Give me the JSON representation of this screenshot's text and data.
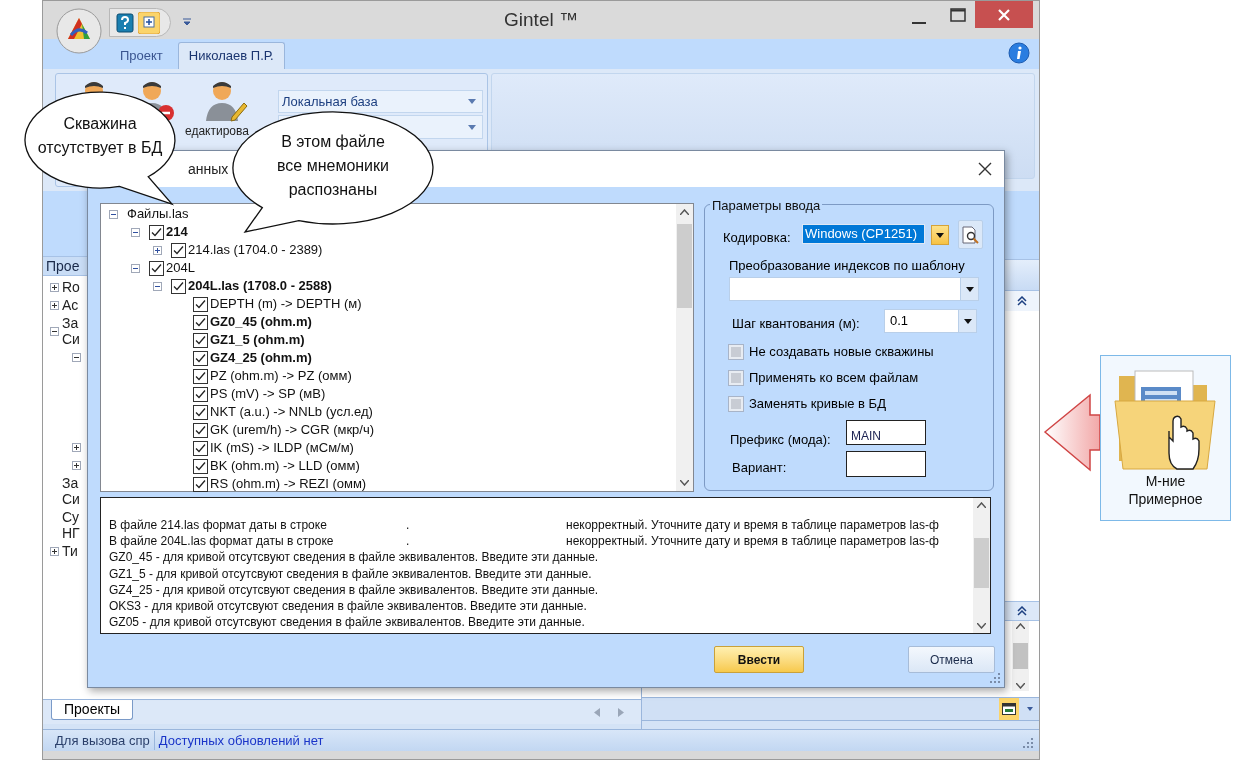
{
  "window": {
    "title": "Gintel ™"
  },
  "ribbon": {
    "tabs": [
      {
        "label": "Проект",
        "selected": false
      },
      {
        "label": "Николаев П.Р.",
        "selected": true
      }
    ],
    "edit_label": "едактирова",
    "database": {
      "value": "Локальная база"
    }
  },
  "left_panel": {
    "header": "Прое",
    "items": [
      {
        "lines": [
          "Ro"
        ],
        "expanded": false
      },
      {
        "lines": [
          "Ac"
        ],
        "expanded": false
      },
      {
        "lines": [
          "За",
          "Си"
        ],
        "expanded": true,
        "children": [
          {
            "expanded": true
          },
          {
            "expanded": false
          },
          {
            "expanded": false
          }
        ]
      },
      {
        "lines": [
          "За",
          "Си"
        ]
      },
      {
        "lines": [
          "Су",
          "НГ"
        ]
      },
      {
        "lines": [
          "Ти"
        ],
        "expanded": false
      }
    ],
    "tabs": [
      {
        "label": "Проекты",
        "selected": true
      }
    ]
  },
  "status_bar": [
    {
      "text": "Для вызова спр",
      "kind": "hint"
    },
    {
      "text": "Доступных обновлений нет",
      "kind": "info"
    }
  ],
  "dialog": {
    "title": "анных",
    "tree": {
      "label": "Файлы.las",
      "expanded": true,
      "children": [
        {
          "label": "214",
          "bold": true,
          "checked": true,
          "expanded": true,
          "children": [
            {
              "label": "214.las (1704.0 - 2389)",
              "bold": false,
              "checked": true,
              "expanded": false
            }
          ]
        },
        {
          "label": "204L",
          "bold": false,
          "checked": true,
          "expanded": true,
          "children": [
            {
              "label": "204L.las (1708.0 - 2588)",
              "bold": true,
              "checked": true,
              "expanded": true,
              "children": [
                {
                  "label": "DEPTH (m) -> DEPTH (м)",
                  "bold": false,
                  "checked": true
                },
                {
                  "label": "GZ0_45 (ohm.m)",
                  "bold": true,
                  "checked": true
                },
                {
                  "label": "GZ1_5 (ohm.m)",
                  "bold": true,
                  "checked": true
                },
                {
                  "label": "GZ4_25 (ohm.m)",
                  "bold": true,
                  "checked": true
                },
                {
                  "label": "PZ (ohm.m) -> PZ (омм)",
                  "bold": false,
                  "checked": true
                },
                {
                  "label": "PS (mV) -> SP (мВ)",
                  "bold": false,
                  "checked": true
                },
                {
                  "label": "NKT (a.u.) -> NNLb (усл.ед)",
                  "bold": false,
                  "checked": true
                },
                {
                  "label": "GK (urem/h) -> CGR (мкр/ч)",
                  "bold": false,
                  "checked": true
                },
                {
                  "label": "IK (mS) -> ILDP (мСм/м)",
                  "bold": false,
                  "checked": true
                },
                {
                  "label": "BK (ohm.m) -> LLD (омм)",
                  "bold": false,
                  "checked": true
                },
                {
                  "label": "RS (ohm.m) -> REZI (омм)",
                  "bold": false,
                  "checked": true
                }
              ]
            }
          ]
        }
      ]
    },
    "params": {
      "title": "Параметры ввода",
      "encoding": {
        "label": "Кодировка:",
        "value": "Windows (CP1251)"
      },
      "template": {
        "label": "Преобразование индексов по шаблону"
      },
      "step": {
        "label": "Шаг квантования (м):",
        "value": "0.1"
      },
      "options": [
        {
          "label": "Не создавать новые скважины",
          "checked": false
        },
        {
          "label": "Применять ко всем файлам",
          "checked": false
        },
        {
          "label": "Заменять кривые в БД",
          "checked": false
        }
      ],
      "prefix": {
        "label": "Префикс (мода):",
        "value": "MAIN"
      },
      "variant": {
        "label": "Вариант:"
      }
    },
    "log": [
      {
        "parts": [
          "В файле 214.las формат даты в строке",
          ".",
          "некорректный. Уточните дату и время в таблице параметров las-ф"
        ]
      },
      {
        "parts": [
          "В файле 204L.las формат даты в строке",
          ".",
          "некорректный. Уточните дату и время в таблице параметров las-ф"
        ]
      },
      {
        "parts": [
          "GZ0_45 - для кривой отсутсвуют сведения в файле эквивалентов. Введите эти данные."
        ]
      },
      {
        "parts": [
          "GZ1_5 - для кривой отсутсвуют сведения в файле эквивалентов. Введите эти данные."
        ]
      },
      {
        "parts": [
          "GZ4_25 - для кривой отсутсвуют сведения в файле эквивалентов. Введите эти данные."
        ]
      },
      {
        "parts": [
          "OKS3 - для кривой отсутсвуют сведения в файле эквивалентов. Введите эти данные."
        ]
      },
      {
        "parts": [
          "GZ05 - для кривой отсутсвуют сведения в файле эквивалентов. Введите эти данные."
        ]
      }
    ],
    "buttons": [
      {
        "label": "Ввести",
        "kind": "primary"
      },
      {
        "label": "Отмена",
        "kind": "default"
      }
    ]
  },
  "callouts": [
    {
      "lines": [
        "Скважина",
        "отсутствует в БД"
      ]
    },
    {
      "lines": [
        "В этом файле",
        "все мнемоники",
        "распознаны"
      ]
    }
  ],
  "desktop_icon": {
    "lines": [
      "М-ние",
      "Примерное"
    ],
    "selected": true
  }
}
